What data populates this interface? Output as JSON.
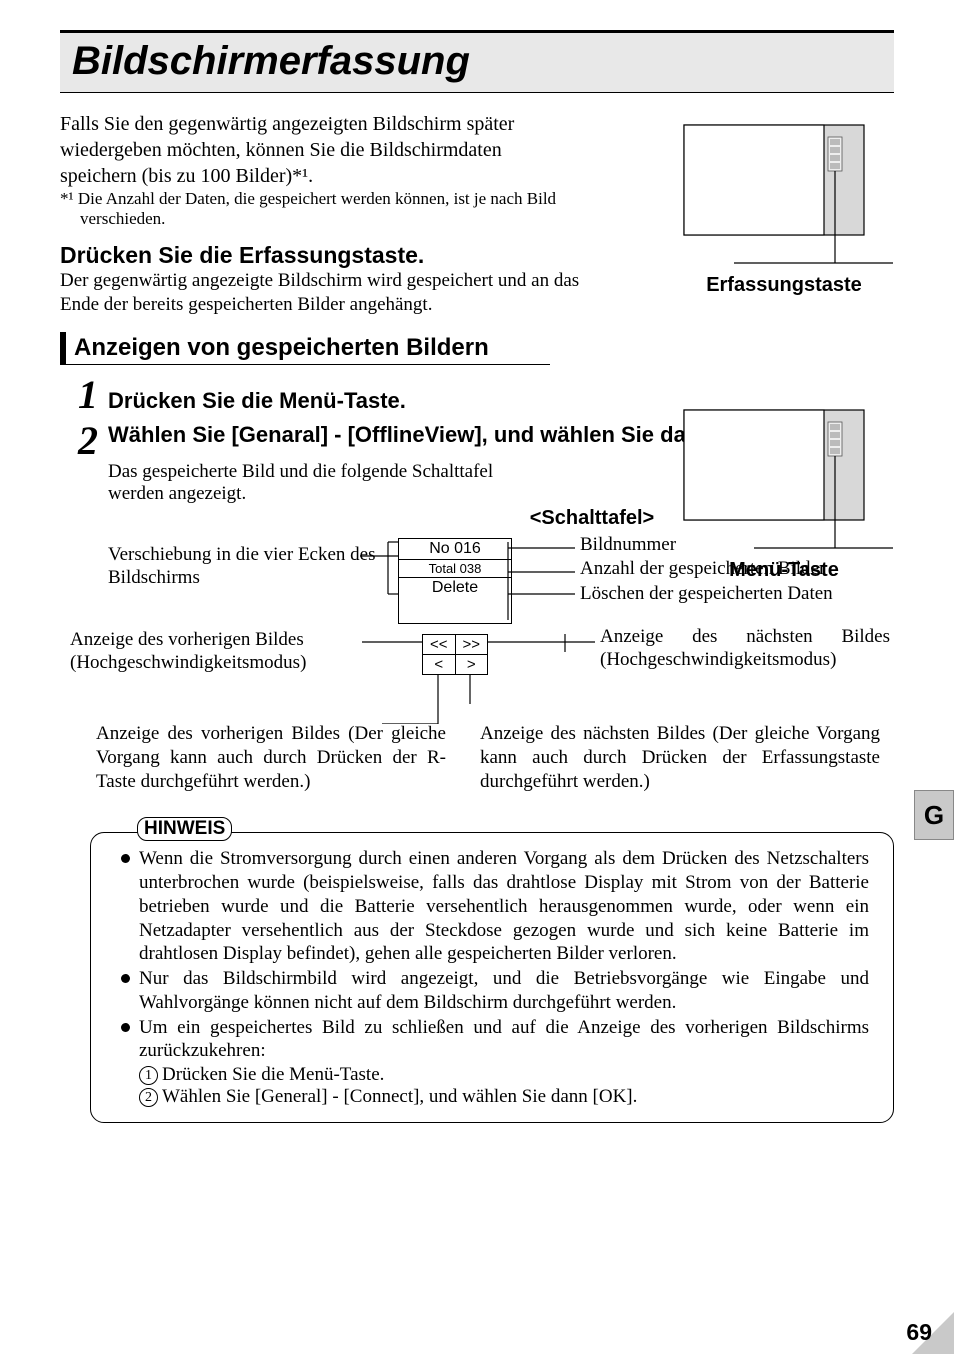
{
  "title": "Bildschirmerfassung",
  "intro": "Falls Sie den gegenwärtig angezeigten Bildschirm später wiedergeben möchten, können Sie die Bildschirmdaten speichern (bis zu 100 Bilder)*¹.",
  "footnote": "*¹ Die Anzahl der Daten, die gespeichert werden können, ist je nach Bild verschieden.",
  "press_heading": "Drücken Sie die Erfassungstaste.",
  "press_body": "Der gegenwärtig angezeigte Bildschirm wird gespeichert und an das Ende der bereits gespeicherten Bilder angehängt.",
  "fig1_caption": "Erfassungstaste",
  "section": "Anzeigen von gespeicherten Bildern",
  "steps": [
    {
      "num": "1",
      "title": "Drücken Sie die Menü-Taste."
    },
    {
      "num": "2",
      "title": "Wählen Sie [Genaral] - [OfflineView], und wählen Sie dann [OK].",
      "body": "Das gespeicherte Bild und die folgende Schalttafel werden angezeigt."
    }
  ],
  "fig2_caption": "Menü-Taste",
  "schalt_title": "<Schalttafel>",
  "panel": {
    "no": "No 016",
    "total": "Total 038",
    "delete": "Delete",
    "fast_prev": "<<",
    "fast_next": ">>",
    "prev": "<",
    "next": ">"
  },
  "labels": {
    "corner_shift": "Verschiebung in die vier Ecken des Bildschirms",
    "prev_fast": "Anzeige des vorherigen Bildes (Hochgeschwindigkeitsmodus)",
    "prev_below": "Anzeige des vorherigen Bildes (Der gleiche Vorgang kann auch durch Drücken der R-Taste durchgeführt werden.)",
    "image_no": "Bildnummer",
    "total_count": "Anzahl der gespeicherten Bilder",
    "delete_data": "Löschen der gespeicherten Daten",
    "next_fast": "Anzeige des nächsten Bildes (Hochgeschwindigkeitsmodus)",
    "next_below": "Anzeige des nächsten Bildes (Der gleiche Vorgang kann auch durch Drücken der Erfassungstaste durchgeführt werden.)"
  },
  "note_label": "HINWEIS",
  "notes": [
    "Wenn die Stromversorgung durch einen anderen Vorgang als dem Drücken des Netzschalters unterbrochen wurde (beispielsweise, falls das drahtlose Display mit Strom von der Batterie betrieben wurde und die Batterie versehentlich herausgenommen wurde, oder wenn ein Netzadapter versehentlich aus der Steckdose gezogen wurde und sich keine Batterie im drahtlosen Display befindet), gehen alle gespeicherten Bilder verloren.",
    "Nur das Bildschirmbild wird angezeigt, und die Betriebsvorgänge wie Eingabe und Wahlvorgänge können nicht auf dem Bildschirm durchgeführt werden.",
    "Um ein gespeichertes Bild zu schließen und auf die Anzeige des vorherigen Bildschirms zurückzukehren:"
  ],
  "note_substeps": [
    "Drücken Sie die Menü-Taste.",
    "Wählen Sie [General] - [Connect], und wählen Sie dann [OK]."
  ],
  "side_tab": "G",
  "page_number": "69"
}
